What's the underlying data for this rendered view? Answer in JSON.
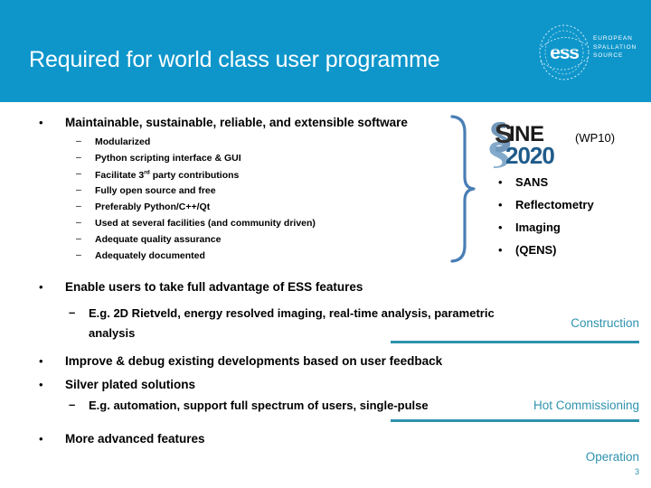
{
  "header": {
    "title": "Required for world class user programme",
    "band_color": "#0E96CB",
    "logo": {
      "name": "ess-logo",
      "wordmark": "ess",
      "line1": "EUROPEAN",
      "line2": "SPALLATION",
      "line3": "SOURCE"
    }
  },
  "body": {
    "bullets": [
      {
        "marker": "•",
        "text": "Maintainable, sustainable, reliable, and extensible software",
        "sub": [
          "Modularized",
          "Python scripting interface & GUI",
          "Facilitate 3rd party contributions",
          "Fully open source and free",
          "Preferably Python/C++/Qt",
          "Used at several facilities (and community driven)",
          "Adequate quality assurance",
          "Adequately documented"
        ]
      },
      {
        "marker": "•",
        "text": "Enable users to take full advantage of ESS features",
        "sub_large": [
          "E.g. 2D Rietveld, energy resolved imaging, real-time analysis, parametric analysis"
        ]
      },
      {
        "marker": "•",
        "text": "Improve & debug existing developments based on user feedback"
      },
      {
        "marker": "•",
        "text": "Silver plated solutions",
        "sub_large": [
          "E.g. automation, support full spectrum of users, single-pulse"
        ]
      },
      {
        "marker": "•",
        "text": "More advanced features"
      }
    ],
    "sub_dash": "–",
    "sub_dash_large": "–"
  },
  "sine": {
    "logo_top": "SINE",
    "logo_bottom": "2020",
    "wp_label": "(WP10)",
    "techniques": [
      {
        "marker": "•",
        "label": "SANS"
      },
      {
        "marker": "•",
        "label": "Reflectometry"
      },
      {
        "marker": "•",
        "label": "Imaging"
      },
      {
        "marker": "•",
        "label": "(QENS)"
      }
    ]
  },
  "timeline": {
    "accent_color": "#2E92AE",
    "phases": [
      {
        "label": "Construction"
      },
      {
        "label": "Hot Commissioning"
      },
      {
        "label": "Operation"
      }
    ]
  },
  "footer": {
    "page_number": "3"
  }
}
